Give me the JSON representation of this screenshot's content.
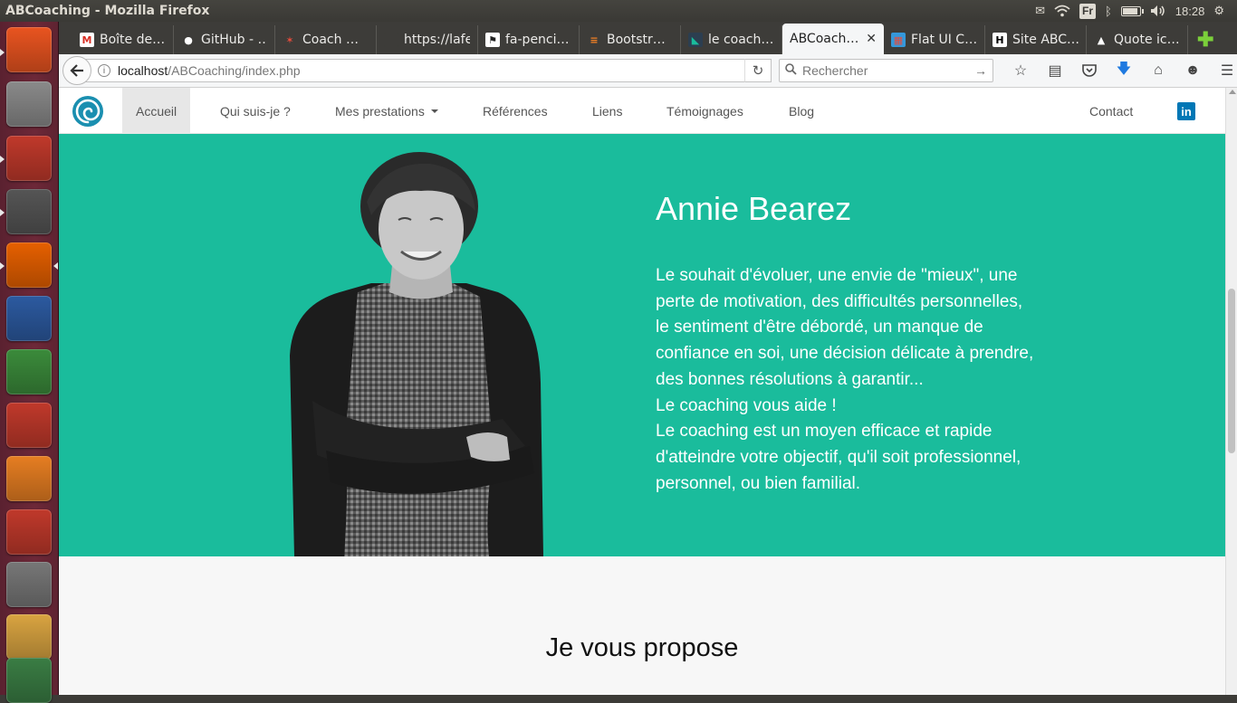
{
  "window": {
    "title": "ABCoaching - Mozilla Firefox"
  },
  "system_panel": {
    "keyboard_layout": "Fr",
    "clock": "18:28"
  },
  "launcher": {
    "items": [
      {
        "name": "ubuntu-dash",
        "color": "#e95420"
      },
      {
        "name": "files",
        "color": "#8a8a8a"
      },
      {
        "name": "terminal",
        "color": "#c0392b"
      },
      {
        "name": "sublime-text",
        "color": "#555555"
      },
      {
        "name": "firefox",
        "color": "#e66000"
      },
      {
        "name": "libreoffice-writer",
        "color": "#2c5aa0"
      },
      {
        "name": "libreoffice-calc",
        "color": "#3b8b3b"
      },
      {
        "name": "libreoffice-impress",
        "color": "#c0392b"
      },
      {
        "name": "software-center",
        "color": "#e67e22"
      },
      {
        "name": "system-settings",
        "color": "#c0392b"
      },
      {
        "name": "gimp",
        "color": "#777777"
      },
      {
        "name": "image-viewer",
        "color": "#d9a441"
      },
      {
        "name": "workspace",
        "color": "#3a7d44"
      }
    ]
  },
  "tabs": [
    {
      "label": "Boîte de…",
      "fav": "M",
      "fav_color": "#d93025",
      "fav_bg": "#ffffff"
    },
    {
      "label": "GitHub - …",
      "fav": "●",
      "fav_color": "#ffffff",
      "fav_bg": "#3d3c39"
    },
    {
      "label": "Coach …",
      "fav": "✶",
      "fav_color": "#e74c3c",
      "fav_bg": "#3d3c39"
    },
    {
      "label": "https://lafe…",
      "fav": "",
      "fav_color": "#3d3c39",
      "fav_bg": "#3d3c39"
    },
    {
      "label": "fa-penci…",
      "fav": "⚑",
      "fav_color": "#222222",
      "fav_bg": "#ffffff"
    },
    {
      "label": "Bootstr…",
      "fav": "≡",
      "fav_color": "#f48024",
      "fav_bg": "#3d3c39"
    },
    {
      "label": "le coach…",
      "fav": "◣",
      "fav_color": "#1abc9c",
      "fav_bg": "#2c3e50"
    },
    {
      "label": "ABCoach…",
      "fav": "",
      "fav_color": "#ffffff",
      "fav_bg": "#f5f6f7",
      "active": true
    },
    {
      "label": "Flat UI C…",
      "fav": "▦",
      "fav_color": "#e74c3c",
      "fav_bg": "#3498db"
    },
    {
      "label": "Site ABC…",
      "fav": "H",
      "fav_color": "#000000",
      "fav_bg": "#ffffff"
    },
    {
      "label": "Quote ic…",
      "fav": "▲",
      "fav_color": "#ffffff",
      "fav_bg": "#3d3c39"
    }
  ],
  "navbar": {
    "url_host": "localhost",
    "url_path": "/ABCoaching/index.php",
    "search_placeholder": "Rechercher"
  },
  "site": {
    "accent": "#1abc9c",
    "nav": [
      {
        "label": "Accueil",
        "active": true
      },
      {
        "label": "Qui suis-je ?"
      },
      {
        "label": "Mes prestations",
        "dropdown": true
      },
      {
        "label": "Références"
      },
      {
        "label": "Liens"
      },
      {
        "label": "Témoignages"
      },
      {
        "label": "Blog"
      }
    ],
    "contact_label": "Contact",
    "linkedin_label": "in",
    "hero": {
      "name": "Annie Bearez",
      "paragraph_1": "Le souhait d'évoluer, une envie de \"mieux\", une perte de motivation, des difficultés personnelles, le sentiment d'être débordé, un manque de confiance en soi, une décision délicate à prendre, des bonnes résolutions à garantir...",
      "paragraph_2": "Le coaching vous aide !",
      "paragraph_3": "Le coaching est un moyen efficace et rapide d'atteindre votre objectif, qu'il soit professionnel, personnel, ou bien familial."
    },
    "section_title": "Je vous propose"
  }
}
